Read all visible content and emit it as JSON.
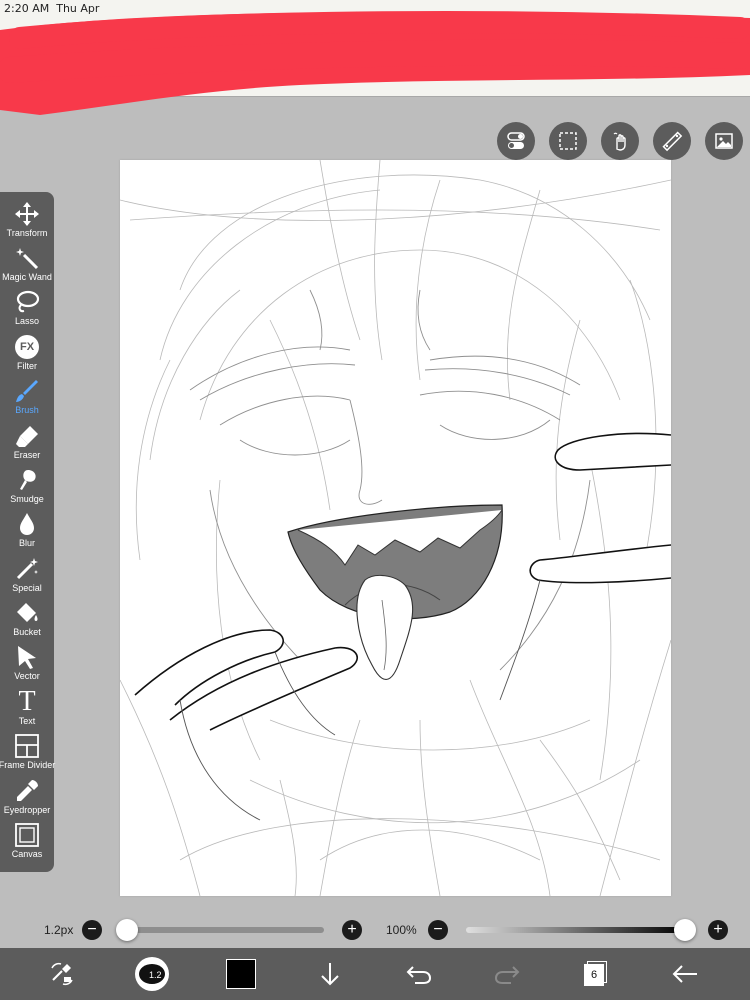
{
  "status_bar": {
    "time": "2:20 AM",
    "date": "Thu Apr"
  },
  "colors": {
    "toolbar": "#5c5c5c",
    "accent": "#5aa8ff",
    "redaction": "#f8394a",
    "workspace": "#bdbdbd"
  },
  "top_tools": [
    {
      "icon": "toggle-icon"
    },
    {
      "icon": "selection-icon"
    },
    {
      "icon": "hand-icon"
    },
    {
      "icon": "ruler-icon"
    },
    {
      "icon": "image-icon"
    }
  ],
  "tools": {
    "transform": "Transform",
    "magic_wand": "Magic Wand",
    "lasso": "Lasso",
    "filter": "Filter",
    "filter_badge": "FX",
    "brush": "Brush",
    "eraser": "Eraser",
    "smudge": "Smudge",
    "blur": "Blur",
    "special": "Special",
    "bucket": "Bucket",
    "vector": "Vector",
    "text": "Text",
    "text_glyph": "T",
    "frame_divider": "Frame Divider",
    "eyedropper": "Eyedropper",
    "canvas": "Canvas",
    "active": "brush"
  },
  "brush_size": {
    "label": "1.2px",
    "minus": "−",
    "plus": "+",
    "level": 0.0
  },
  "opacity": {
    "label": "100%",
    "minus": "−",
    "plus": "+",
    "level": 1.0
  },
  "bottom": {
    "brush_preview_label": "1.2",
    "layer_count": "6",
    "current_color": "#000000"
  }
}
